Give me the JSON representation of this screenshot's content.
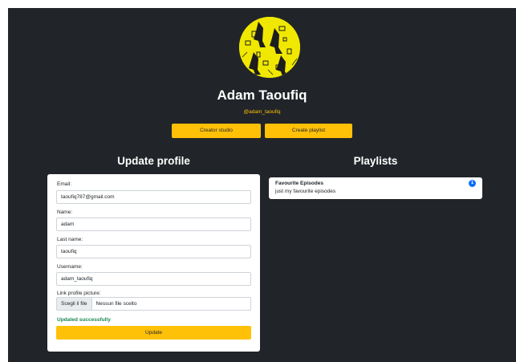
{
  "profile": {
    "name": "Adam Taoufiq",
    "handle": "@adam_taoufiq",
    "avatar_icon": "penguins-avatar-icon",
    "avatar_color": "#f0e800"
  },
  "actions": {
    "creator_studio": "Creator studio",
    "create_playlist": "Create playlist"
  },
  "update_profile": {
    "title": "Update profile",
    "email_label": "Email:",
    "email_value": "taoufiq787@gmail.com",
    "name_label": "Name:",
    "name_value": "adam",
    "last_name_label": "Last name:",
    "last_name_value": "taoufiq",
    "username_label": "Username:",
    "username_value": "adam_taoufiq",
    "picture_label": "Link profile picture:",
    "file_button": "Scegli il file",
    "file_status": "Nessun file scelto",
    "success_message": "Updated successfully",
    "submit_label": "Update"
  },
  "playlists": {
    "title": "Playlists",
    "items": [
      {
        "name": "Favourite Episodes",
        "description": "just my favourite episodes",
        "count": "1"
      }
    ]
  },
  "colors": {
    "background": "#212529",
    "accent": "#ffc107",
    "success": "#198754",
    "badge": "#0d6efd"
  }
}
